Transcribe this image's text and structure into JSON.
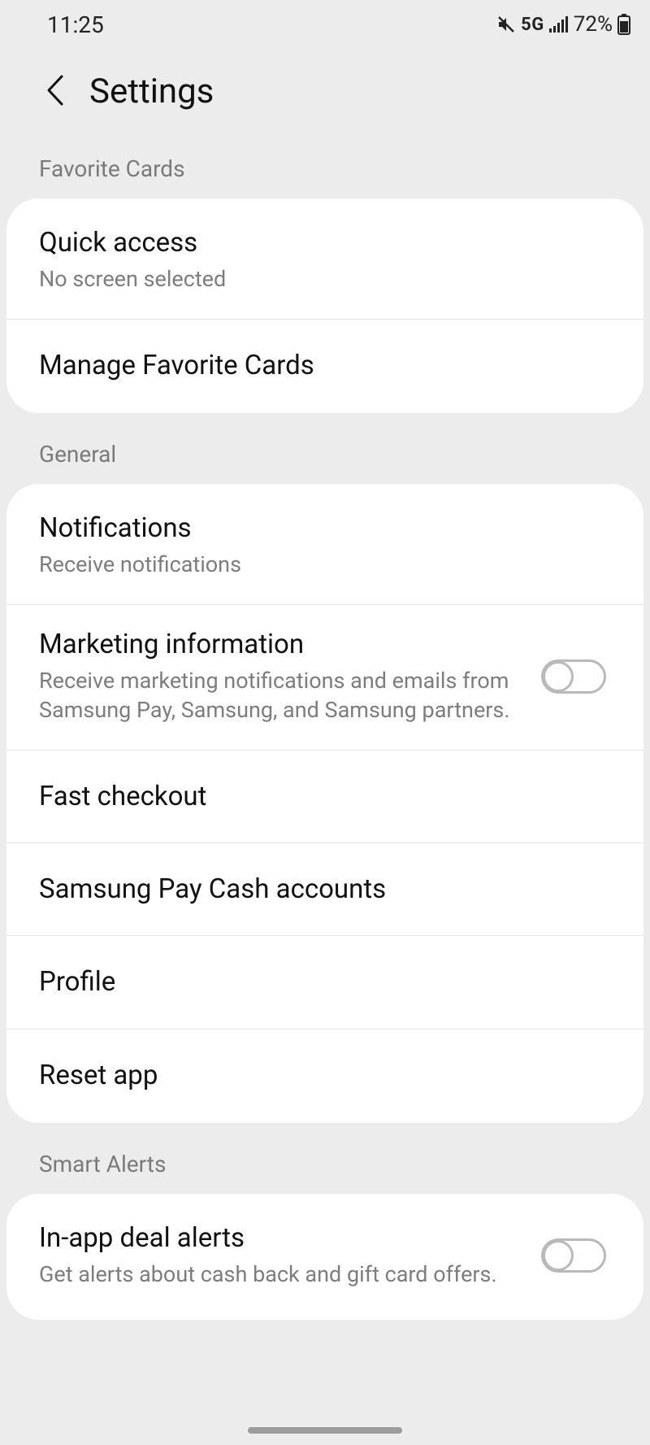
{
  "status": {
    "time": "11:25",
    "network": "5G",
    "battery_pct": "72%"
  },
  "header": {
    "title": "Settings"
  },
  "sections": {
    "favorite_cards": {
      "label": "Favorite Cards",
      "quick_access": {
        "title": "Quick access",
        "sub": "No screen selected"
      },
      "manage": {
        "title": "Manage Favorite Cards"
      }
    },
    "general": {
      "label": "General",
      "notifications": {
        "title": "Notifications",
        "sub": "Receive notifications"
      },
      "marketing": {
        "title": "Marketing information",
        "sub": "Receive marketing notifications and emails from Samsung Pay, Samsung, and Samsung partners.",
        "toggle": false
      },
      "fast_checkout": {
        "title": "Fast checkout"
      },
      "pay_cash": {
        "title": "Samsung Pay Cash accounts"
      },
      "profile": {
        "title": "Profile"
      },
      "reset": {
        "title": "Reset app"
      }
    },
    "smart_alerts": {
      "label": "Smart Alerts",
      "deal_alerts": {
        "title": "In-app deal alerts",
        "sub": "Get alerts about cash back and gift card offers.",
        "toggle": false
      }
    }
  }
}
